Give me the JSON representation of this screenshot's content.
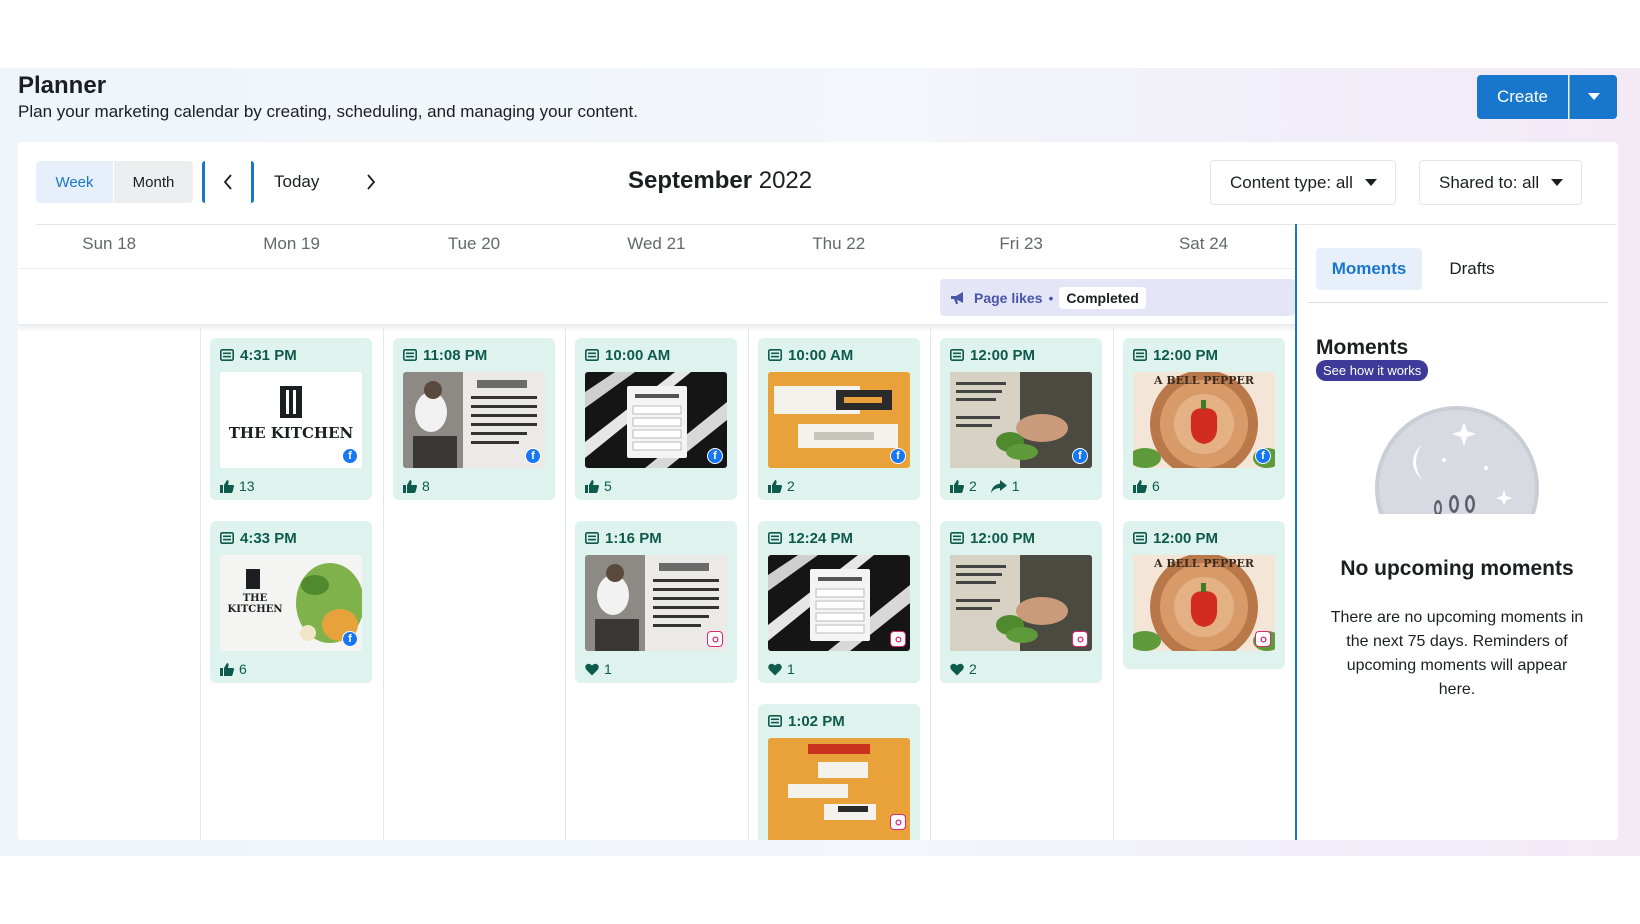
{
  "header": {
    "title": "Planner",
    "subtitle": "Plan your marketing calendar by creating, scheduling, and managing your content.",
    "create_label": "Create"
  },
  "toolbar": {
    "week_label": "Week",
    "month_label": "Month",
    "today_label": "Today",
    "month_name": "September",
    "year": "2022",
    "content_filter": "Content type: all",
    "shared_filter": "Shared to: all"
  },
  "days": [
    "Sun 18",
    "Mon 19",
    "Tue 20",
    "Wed 21",
    "Thu 22",
    "Fri 23",
    "Sat 24"
  ],
  "banner": {
    "label": "Page likes",
    "status": "Completed"
  },
  "posts": {
    "mon_1": {
      "time": "4:31 PM",
      "likes": "13",
      "platform": "facebook",
      "image": "THE KITCHEN logo"
    },
    "mon_2": {
      "time": "4:33 PM",
      "likes": "6",
      "platform": "facebook",
      "image": "THE KITCHEN logo with vegetables"
    },
    "tue_1": {
      "time": "11:08 PM",
      "likes": "8",
      "platform": "facebook",
      "image": "chef with quote"
    },
    "wed_1": {
      "time": "10:00 AM",
      "likes": "5",
      "platform": "facebook",
      "image": "knife poll"
    },
    "wed_2": {
      "time": "1:16 PM",
      "hearts": "1",
      "platform": "instagram",
      "image": "chef with quote"
    },
    "thu_1": {
      "time": "10:00 AM",
      "likes": "2",
      "platform": "facebook",
      "image": "orange promo"
    },
    "thu_2": {
      "time": "12:24 PM",
      "hearts": "1",
      "platform": "instagram",
      "image": "knife poll"
    },
    "thu_3": {
      "time": "1:02 PM",
      "platform": "instagram",
      "image": "orange promo"
    },
    "fri_1": {
      "time": "12:00 PM",
      "likes": "2",
      "shares": "1",
      "platform": "facebook",
      "image": "cutting herbs tips"
    },
    "fri_2": {
      "time": "12:00 PM",
      "hearts": "2",
      "platform": "instagram",
      "image": "cutting herbs tips"
    },
    "sat_1": {
      "time": "12:00 PM",
      "likes": "6",
      "platform": "facebook",
      "image": "A BELL PEPPER infographic",
      "image_text": "A BELL PEPPER"
    },
    "sat_2": {
      "time": "12:00 PM",
      "platform": "instagram",
      "image": "A BELL PEPPER infographic",
      "image_text": "A BELL PEPPER"
    }
  },
  "thumb_text": {
    "kitchen": "THE KITCHEN"
  },
  "sidebar": {
    "tab_moments": "Moments",
    "tab_drafts": "Drafts",
    "title": "Moments",
    "see_how": "See how it works",
    "empty_title": "No upcoming moments",
    "empty_text": "There are no upcoming moments in the next 75 days. Reminders of upcoming moments will appear here."
  },
  "colors": {
    "accent": "#1877cc",
    "card_bg": "#dff3ee",
    "card_text": "#0e5a4d",
    "banner_bg": "#e4e6f7",
    "pill_bg": "#3e3a99"
  }
}
